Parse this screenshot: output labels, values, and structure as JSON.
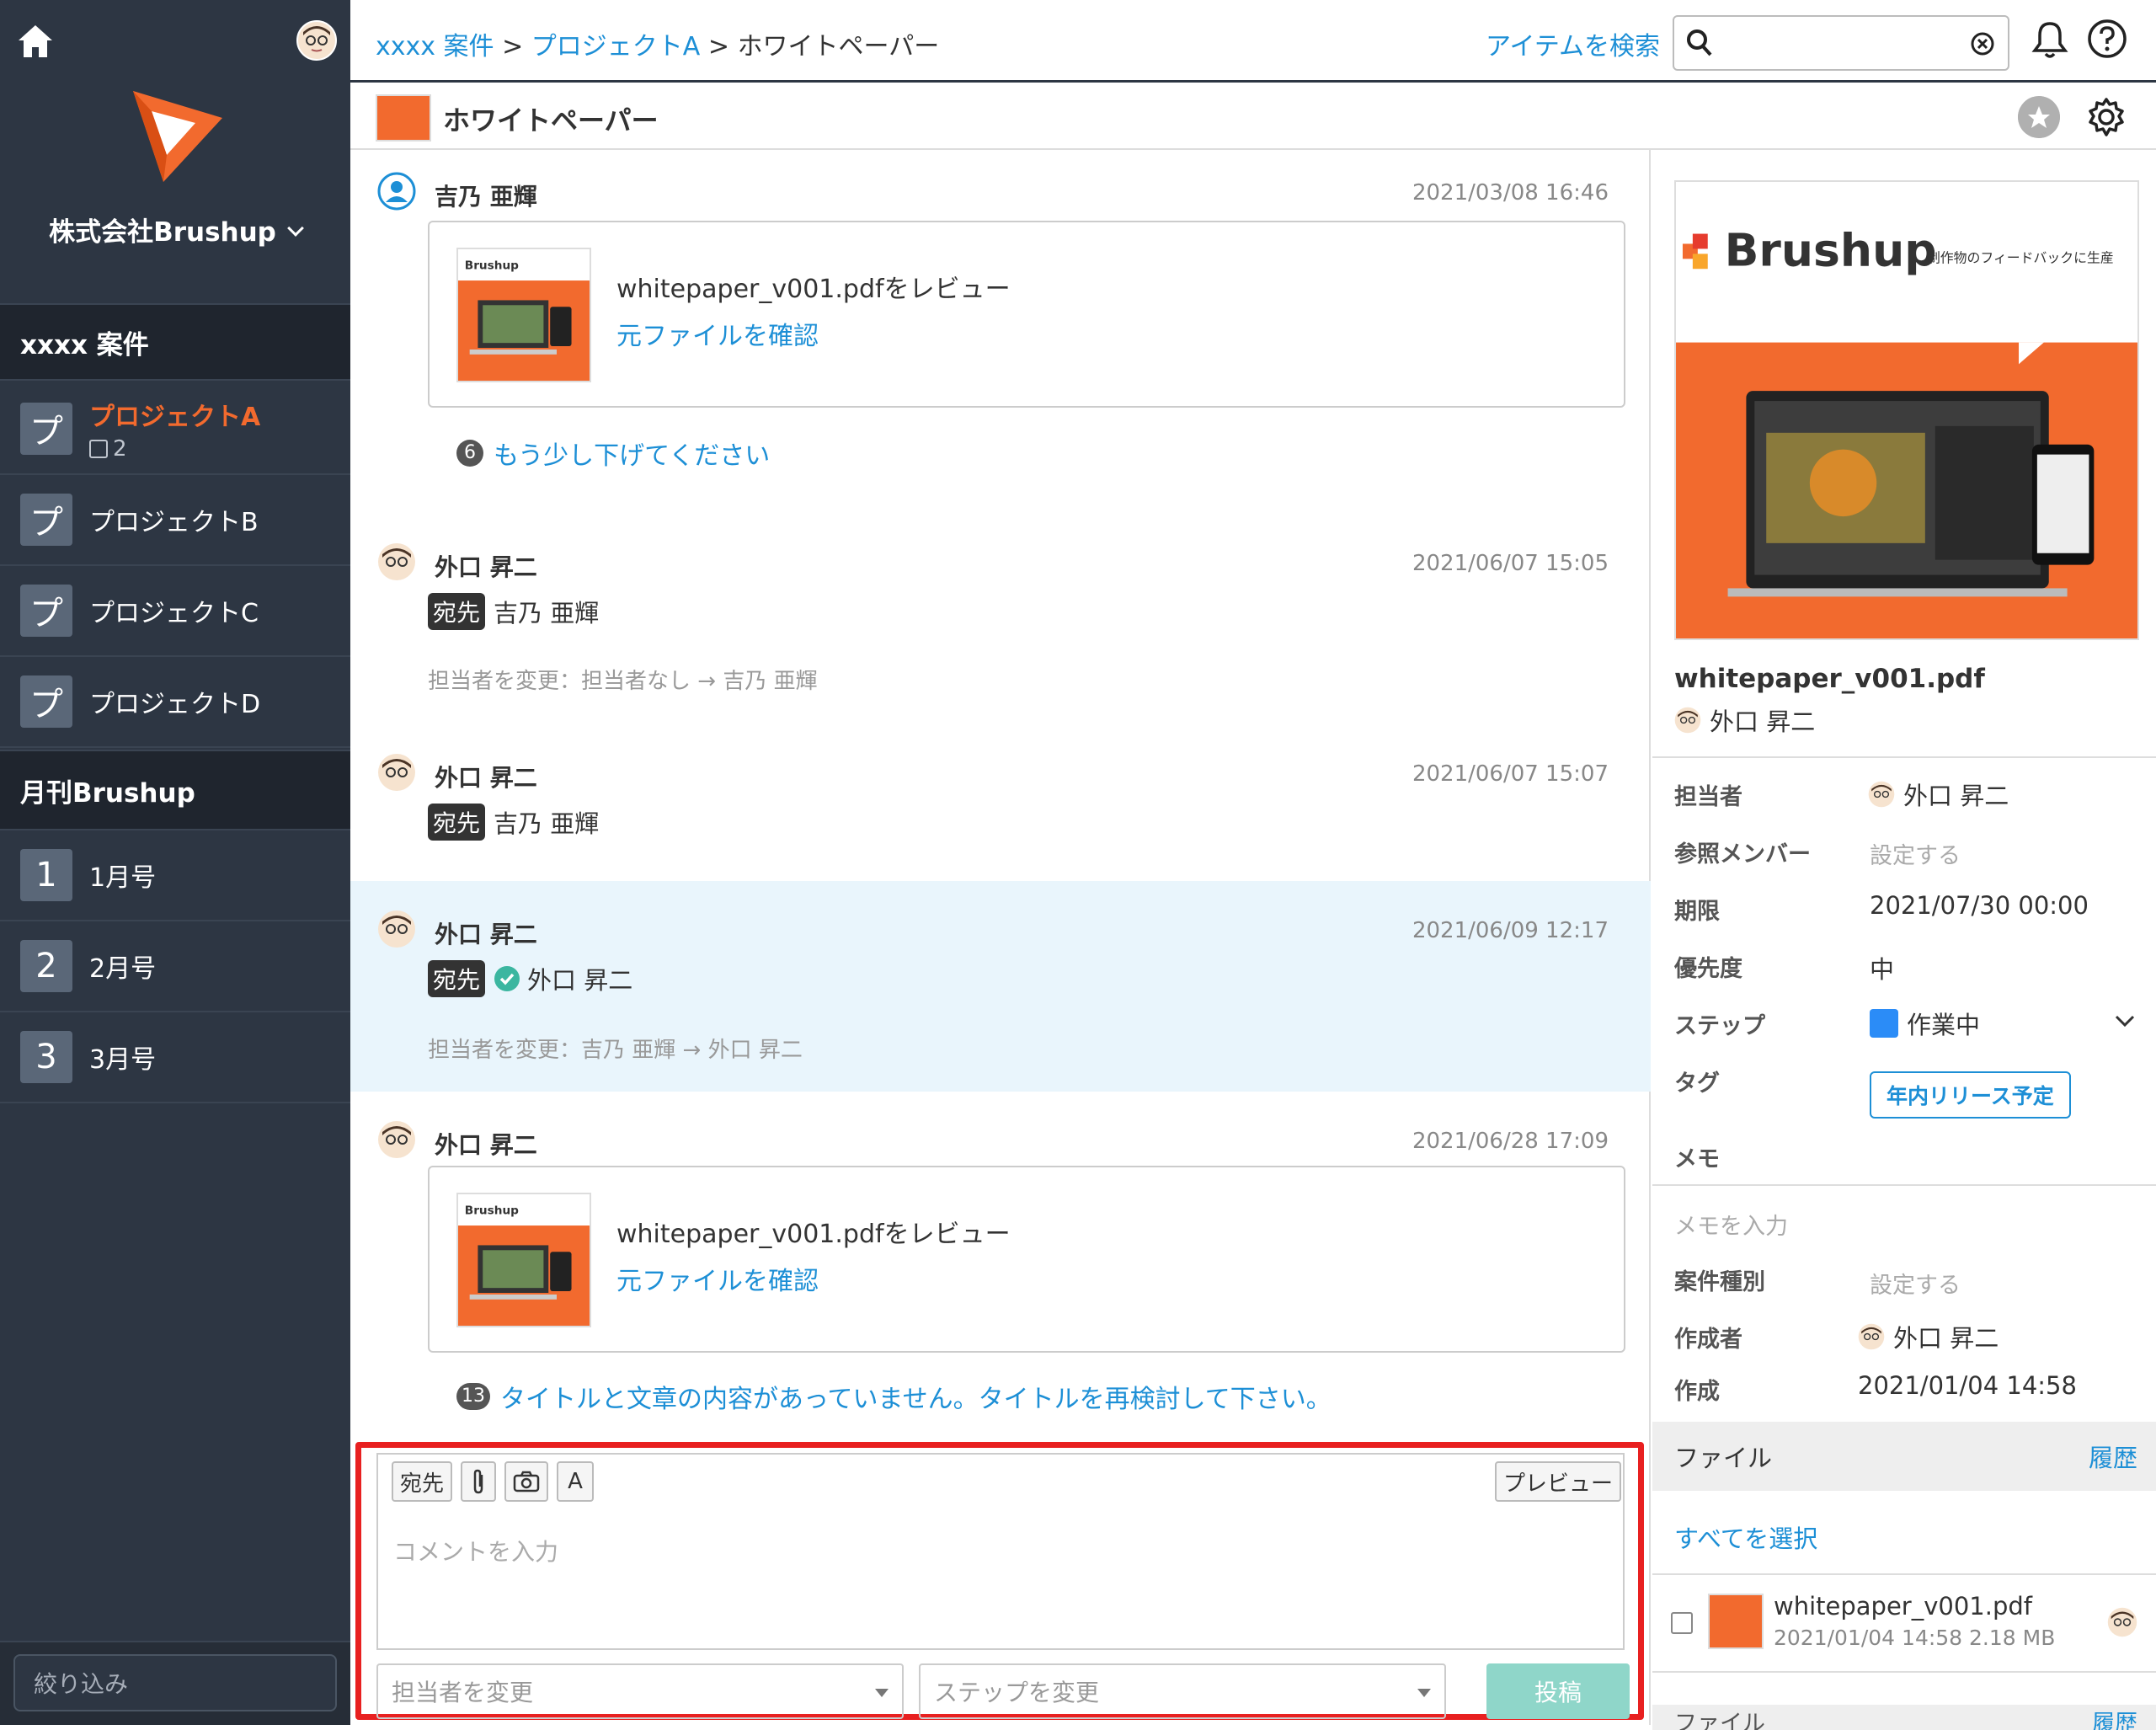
{
  "company": "株式会社Brushup",
  "sidebar": {
    "section1": "xxxx 案件",
    "projects": [
      {
        "icon": "プ",
        "label": "プロジェクトA",
        "count": "2",
        "active": true
      },
      {
        "icon": "プ",
        "label": "プロジェクトB"
      },
      {
        "icon": "プ",
        "label": "プロジェクトC"
      },
      {
        "icon": "プ",
        "label": "プロジェクトD"
      }
    ],
    "section2": "月刊Brushup",
    "issues": [
      {
        "icon": "1",
        "label": "1月号"
      },
      {
        "icon": "2",
        "label": "2月号"
      },
      {
        "icon": "3",
        "label": "3月号"
      }
    ],
    "filter_placeholder": "絞り込み"
  },
  "header": {
    "breadcrumb": [
      "xxxx 案件",
      "プロジェクトA",
      "ホワイトペーパー"
    ],
    "separator": ">",
    "search_link": "アイテムを検索",
    "search_value": ""
  },
  "item": {
    "title": "ホワイトペーパー"
  },
  "comments": [
    {
      "author": "吉乃 亜輝",
      "time": "2021/03/08 16:46",
      "file": "whitepaper_v001.pdfをレビュー",
      "link": "元ファイルを確認",
      "annotation_num": "6",
      "annotation": "もう少し下げてください"
    },
    {
      "author": "外口 昇二",
      "time": "2021/06/07 15:05",
      "to_label": "宛先",
      "to": "吉乃 亜輝",
      "change": "担当者を変更：担当者なし → 吉乃 亜輝"
    },
    {
      "author": "外口 昇二",
      "time": "2021/06/07 15:07",
      "to_label": "宛先",
      "to": "吉乃 亜輝"
    },
    {
      "author": "外口 昇二",
      "time": "2021/06/09 12:17",
      "to_label": "宛先",
      "to": "外口 昇二",
      "change": "担当者を変更：吉乃 亜輝 → 外口 昇二"
    },
    {
      "author": "外口 昇二",
      "time": "2021/06/28 17:09",
      "file": "whitepaper_v001.pdfをレビュー",
      "link": "元ファイルを確認",
      "annotation_num": "13",
      "annotation": "タイトルと文章の内容があっていません。タイトルを再検討して下さい。"
    }
  ],
  "editor": {
    "to_btn": "宛先",
    "font_btn": "A",
    "preview_btn": "プレビュー",
    "placeholder": "コメントを入力",
    "assignee_placeholder": "担当者を変更",
    "step_placeholder": "ステップを変更",
    "post_btn": "投稿"
  },
  "detail": {
    "thumb_brand": "Brushup",
    "thumb_tagline": "制作物のフィードバックに生産",
    "file_name": "whitepaper_v001.pdf",
    "file_author": "外口 昇二",
    "props": {
      "assignee_label": "担当者",
      "assignee": "外口 昇二",
      "members_label": "参照メンバー",
      "members": "設定する",
      "due_label": "期限",
      "due": "2021/07/30 00:00",
      "priority_label": "優先度",
      "priority": "中",
      "step_label": "ステップ",
      "step": "作業中",
      "tag_label": "タグ",
      "tag": "年内リリース予定",
      "memo_label": "メモ",
      "memo_placeholder": "メモを入力",
      "type_label": "案件種別",
      "type": "設定する",
      "creator_label": "作成者",
      "creator": "外口 昇二",
      "created_label": "作成",
      "created": "2021/01/04 14:58"
    },
    "files_header": "ファイル",
    "history": "履歴",
    "select_all": "すべてを選択",
    "file_item": {
      "name": "whitepaper_v001.pdf",
      "meta": "2021/01/04 14:58 2.18 MB"
    },
    "files_header2": "ファイル",
    "history2": "履歴"
  },
  "colors": {
    "sidebar": "#2d3643",
    "accent": "#f26a2e",
    "link": "#1d8fd6",
    "highlight": "#e9f5fc",
    "editor_border": "#e82020"
  }
}
